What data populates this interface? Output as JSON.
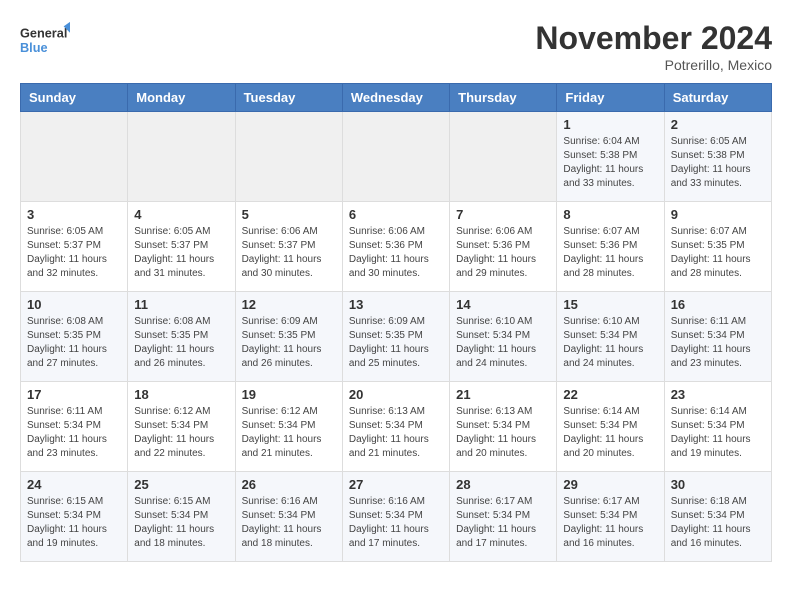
{
  "logo": {
    "line1": "General",
    "line2": "Blue"
  },
  "title": "November 2024",
  "location": "Potrerillo, Mexico",
  "headers": [
    "Sunday",
    "Monday",
    "Tuesday",
    "Wednesday",
    "Thursday",
    "Friday",
    "Saturday"
  ],
  "weeks": [
    [
      {
        "day": "",
        "info": ""
      },
      {
        "day": "",
        "info": ""
      },
      {
        "day": "",
        "info": ""
      },
      {
        "day": "",
        "info": ""
      },
      {
        "day": "",
        "info": ""
      },
      {
        "day": "1",
        "info": "Sunrise: 6:04 AM\nSunset: 5:38 PM\nDaylight: 11 hours\nand 33 minutes."
      },
      {
        "day": "2",
        "info": "Sunrise: 6:05 AM\nSunset: 5:38 PM\nDaylight: 11 hours\nand 33 minutes."
      }
    ],
    [
      {
        "day": "3",
        "info": "Sunrise: 6:05 AM\nSunset: 5:37 PM\nDaylight: 11 hours\nand 32 minutes."
      },
      {
        "day": "4",
        "info": "Sunrise: 6:05 AM\nSunset: 5:37 PM\nDaylight: 11 hours\nand 31 minutes."
      },
      {
        "day": "5",
        "info": "Sunrise: 6:06 AM\nSunset: 5:37 PM\nDaylight: 11 hours\nand 30 minutes."
      },
      {
        "day": "6",
        "info": "Sunrise: 6:06 AM\nSunset: 5:36 PM\nDaylight: 11 hours\nand 30 minutes."
      },
      {
        "day": "7",
        "info": "Sunrise: 6:06 AM\nSunset: 5:36 PM\nDaylight: 11 hours\nand 29 minutes."
      },
      {
        "day": "8",
        "info": "Sunrise: 6:07 AM\nSunset: 5:36 PM\nDaylight: 11 hours\nand 28 minutes."
      },
      {
        "day": "9",
        "info": "Sunrise: 6:07 AM\nSunset: 5:35 PM\nDaylight: 11 hours\nand 28 minutes."
      }
    ],
    [
      {
        "day": "10",
        "info": "Sunrise: 6:08 AM\nSunset: 5:35 PM\nDaylight: 11 hours\nand 27 minutes."
      },
      {
        "day": "11",
        "info": "Sunrise: 6:08 AM\nSunset: 5:35 PM\nDaylight: 11 hours\nand 26 minutes."
      },
      {
        "day": "12",
        "info": "Sunrise: 6:09 AM\nSunset: 5:35 PM\nDaylight: 11 hours\nand 26 minutes."
      },
      {
        "day": "13",
        "info": "Sunrise: 6:09 AM\nSunset: 5:35 PM\nDaylight: 11 hours\nand 25 minutes."
      },
      {
        "day": "14",
        "info": "Sunrise: 6:10 AM\nSunset: 5:34 PM\nDaylight: 11 hours\nand 24 minutes."
      },
      {
        "day": "15",
        "info": "Sunrise: 6:10 AM\nSunset: 5:34 PM\nDaylight: 11 hours\nand 24 minutes."
      },
      {
        "day": "16",
        "info": "Sunrise: 6:11 AM\nSunset: 5:34 PM\nDaylight: 11 hours\nand 23 minutes."
      }
    ],
    [
      {
        "day": "17",
        "info": "Sunrise: 6:11 AM\nSunset: 5:34 PM\nDaylight: 11 hours\nand 23 minutes."
      },
      {
        "day": "18",
        "info": "Sunrise: 6:12 AM\nSunset: 5:34 PM\nDaylight: 11 hours\nand 22 minutes."
      },
      {
        "day": "19",
        "info": "Sunrise: 6:12 AM\nSunset: 5:34 PM\nDaylight: 11 hours\nand 21 minutes."
      },
      {
        "day": "20",
        "info": "Sunrise: 6:13 AM\nSunset: 5:34 PM\nDaylight: 11 hours\nand 21 minutes."
      },
      {
        "day": "21",
        "info": "Sunrise: 6:13 AM\nSunset: 5:34 PM\nDaylight: 11 hours\nand 20 minutes."
      },
      {
        "day": "22",
        "info": "Sunrise: 6:14 AM\nSunset: 5:34 PM\nDaylight: 11 hours\nand 20 minutes."
      },
      {
        "day": "23",
        "info": "Sunrise: 6:14 AM\nSunset: 5:34 PM\nDaylight: 11 hours\nand 19 minutes."
      }
    ],
    [
      {
        "day": "24",
        "info": "Sunrise: 6:15 AM\nSunset: 5:34 PM\nDaylight: 11 hours\nand 19 minutes."
      },
      {
        "day": "25",
        "info": "Sunrise: 6:15 AM\nSunset: 5:34 PM\nDaylight: 11 hours\nand 18 minutes."
      },
      {
        "day": "26",
        "info": "Sunrise: 6:16 AM\nSunset: 5:34 PM\nDaylight: 11 hours\nand 18 minutes."
      },
      {
        "day": "27",
        "info": "Sunrise: 6:16 AM\nSunset: 5:34 PM\nDaylight: 11 hours\nand 17 minutes."
      },
      {
        "day": "28",
        "info": "Sunrise: 6:17 AM\nSunset: 5:34 PM\nDaylight: 11 hours\nand 17 minutes."
      },
      {
        "day": "29",
        "info": "Sunrise: 6:17 AM\nSunset: 5:34 PM\nDaylight: 11 hours\nand 16 minutes."
      },
      {
        "day": "30",
        "info": "Sunrise: 6:18 AM\nSunset: 5:34 PM\nDaylight: 11 hours\nand 16 minutes."
      }
    ]
  ]
}
